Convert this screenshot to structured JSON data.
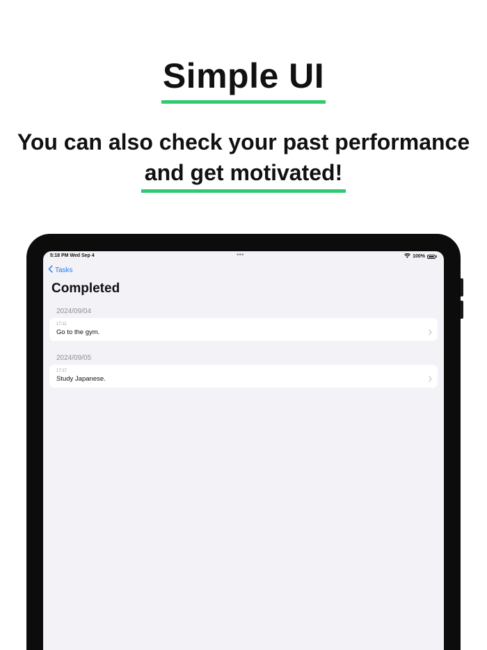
{
  "promo": {
    "title": "Simple UI",
    "subtitle_line1": "You can also check your past performance",
    "subtitle_line2": "and get motivated!",
    "accent_color": "#2fc96f"
  },
  "status_bar": {
    "time_date": "5:18 PM  Wed Sep 4",
    "multitask_dots": "•••",
    "battery": "100%",
    "battery_level": 1.0
  },
  "nav": {
    "back_label": "Tasks",
    "back_icon": "chevron-left-icon",
    "title": "Completed"
  },
  "sections": [
    {
      "date": "2024/09/04",
      "items": [
        {
          "time": "17:11",
          "text": "Go to the gym."
        }
      ]
    },
    {
      "date": "2024/09/05",
      "items": [
        {
          "time": "17:17",
          "text": "Study Japanese."
        }
      ]
    }
  ],
  "colors": {
    "tint": "#1f7cf5",
    "background": "#f2f2f7",
    "secondary_text": "#8e8e93"
  }
}
